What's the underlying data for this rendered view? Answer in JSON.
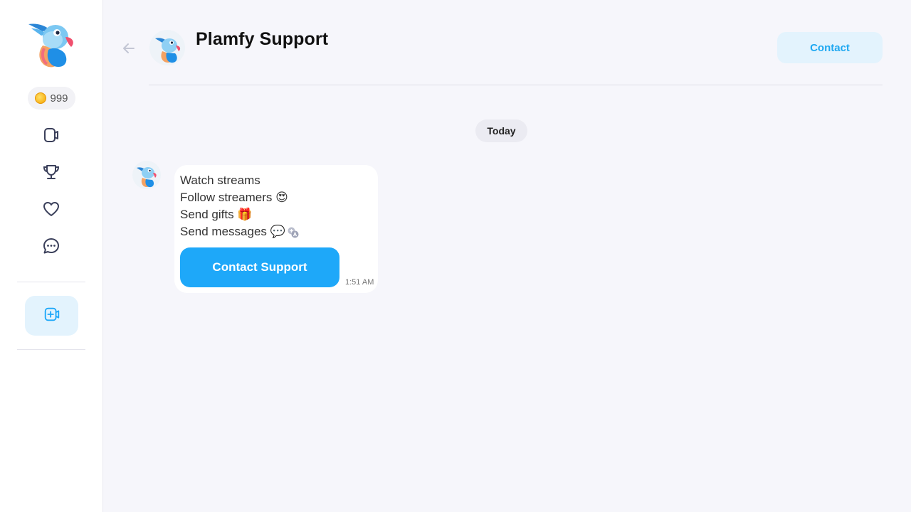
{
  "sidebar": {
    "coins": "999",
    "nav": [
      {
        "icon": "video-icon"
      },
      {
        "icon": "trophy-icon"
      },
      {
        "icon": "heart-icon"
      },
      {
        "icon": "chat-icon"
      }
    ],
    "go_live_icon": "add-video-icon"
  },
  "header": {
    "title": "Plamfy Support",
    "contact_label": "Contact"
  },
  "chat": {
    "date_label": "Today",
    "message": {
      "lines": [
        "Watch streams",
        "Follow streamers 😍",
        "Send gifts 🎁",
        "Send messages 💬"
      ],
      "button_label": "Contact Support",
      "time": "1:51 AM"
    }
  },
  "colors": {
    "accent": "#1ea8f9",
    "accent_light": "#e3f3fd",
    "background": "#f6f6fb"
  }
}
